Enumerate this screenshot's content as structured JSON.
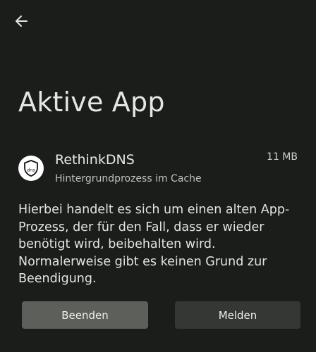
{
  "header": {
    "back_icon": "arrow-left-icon"
  },
  "page": {
    "title": "Aktive App"
  },
  "app": {
    "icon": "rethinkdns-shield-icon",
    "icon_text": "dns",
    "name": "RethinkDNS",
    "status": "Hintergrundprozess im Cache",
    "size": "11 MB"
  },
  "description": "Hierbei handelt es sich um einen alten App-Prozess, der für den Fall, dass er wieder benötigt wird, beibehalten wird. Normalerweise gibt es keinen Grund zur Beendigung.",
  "actions": {
    "stop_label": "Beenden",
    "report_label": "Melden"
  },
  "colors": {
    "background": "#1b1d1a",
    "primary_button": "#5d5f5b",
    "secondary_button": "#353734",
    "text": "#e4e5e0"
  }
}
